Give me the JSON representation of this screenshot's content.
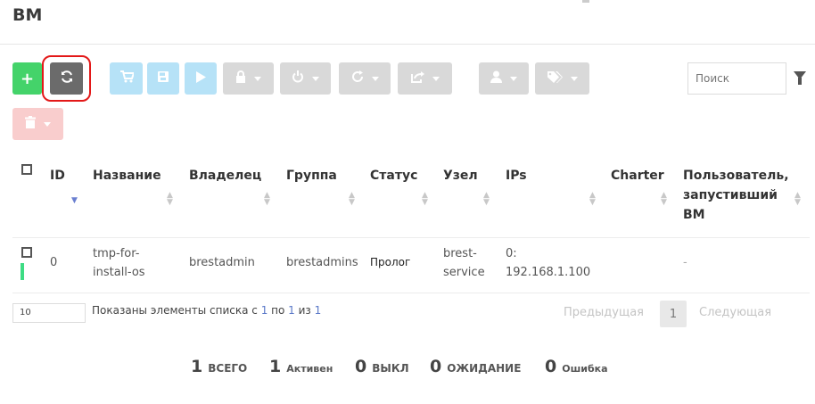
{
  "page": {
    "title": "ВМ"
  },
  "toolbar": {
    "add_label": "+",
    "refresh_icon": "refresh-icon",
    "icons": [
      "cart-icon",
      "save-icon",
      "play-icon",
      "lock-icon",
      "power-icon",
      "reboot-icon",
      "export-icon",
      "user-icon",
      "tags-icon",
      "trash-icon"
    ],
    "colors": {
      "add": "#44d36a",
      "refresh": "#6b6b6b",
      "highlight": "#e31818"
    }
  },
  "search": {
    "placeholder": "Поиск"
  },
  "table": {
    "headers": {
      "id": "ID",
      "name": "Название",
      "owner": "Владелец",
      "group": "Группа",
      "status": "Статус",
      "host": "Узел",
      "ips": "IPs",
      "charter": "Charter",
      "started_by_l1": "Пользователь,",
      "started_by_l2": "запустивший",
      "started_by_l3": "ВМ"
    },
    "rows": [
      {
        "id": "0",
        "name_l1": "tmp-for-",
        "name_l2": "install-os",
        "owner": "brestadmin",
        "group": "brestadmins",
        "status": "Пролог",
        "host_l1": "brest-",
        "host_l2": "service",
        "ips_l1": "0:",
        "ips_l2": "192.168.1.100",
        "charter": "",
        "started_by": "-"
      }
    ]
  },
  "footer": {
    "page_length": "10",
    "info_prefix": "Показаны элементы списка с ",
    "info_from": "1",
    "info_mid1": " по ",
    "info_to": "1",
    "info_mid2": " из ",
    "info_total": "1",
    "prev": "Предыдущая",
    "current_page": "1",
    "next": "Следующая"
  },
  "summary": {
    "total_num": "1",
    "total_lbl": "ВСЕГО",
    "active_num": "1",
    "active_lbl": "Активен",
    "off_num": "0",
    "off_lbl": "ВЫКЛ",
    "pending_num": "0",
    "pending_lbl": "ОЖИДАНИЕ",
    "error_num": "0",
    "error_lbl": "Ошибка"
  }
}
